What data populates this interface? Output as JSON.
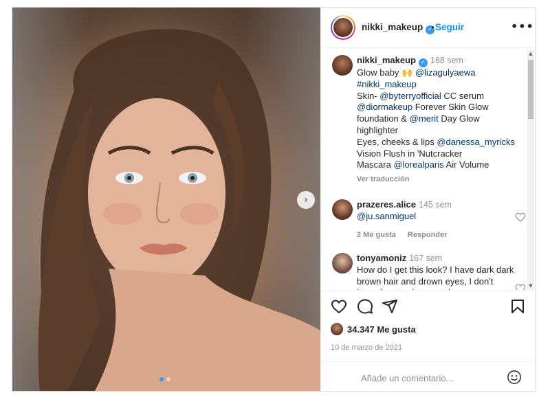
{
  "post": {
    "username": "nikki_makeup",
    "separator": "•",
    "follow_label": "Seguir",
    "more_label": "•••",
    "next_label": "›"
  },
  "caption": {
    "username": "nikki_makeup",
    "time": "168 sem",
    "line1_text": "Glow baby 🙌 ",
    "line1_mention": "@lizagulyaewa",
    "hashtag": "#nikki_makeup",
    "line3_text": "Skin- ",
    "line3_mention": "@byterryofficial",
    "line3_after": " CC serum",
    "line4_mention": "@diormakeup",
    "line4_after": " Forever Skin Glow foundation & ",
    "line4_mention2": "@merit",
    "line4_after2": " Day Glow highlighter",
    "line5_text": "Eyes, cheeks & lips ",
    "line5_mention": "@danessa_myricks",
    "line5_after": " Vision Flush in 'Nutcracker",
    "line6_text": "Mascara ",
    "line6_mention": "@lorealparis",
    "line6_after": " Air Volume",
    "translate_label": "Ver traducción"
  },
  "comments": [
    {
      "username": "prazeres.alice",
      "time": "145 sem",
      "mention": "@ju.sanmiguel",
      "likes_label": "2 Me gusta",
      "reply_label": "Responder"
    },
    {
      "username": "tonyamoniz",
      "time": "167 sem",
      "text": "How do I get this look? I have dark dark brown hair and drown eyes, I don't know how to do my make up"
    }
  ],
  "footer": {
    "likes": "34.347 Me gusta",
    "date": "10 de marzo de 2021",
    "comment_placeholder": "Añade un comentario..."
  },
  "colors": {
    "accent": "#0095f6",
    "verified": "#3897f0",
    "mention": "#00376b",
    "muted": "#8e8e8e"
  },
  "icons": [
    "heart-icon",
    "comment-icon",
    "share-icon",
    "bookmark-icon",
    "emoji-icon",
    "verified-icon",
    "chevron-right-icon",
    "more-icon"
  ]
}
